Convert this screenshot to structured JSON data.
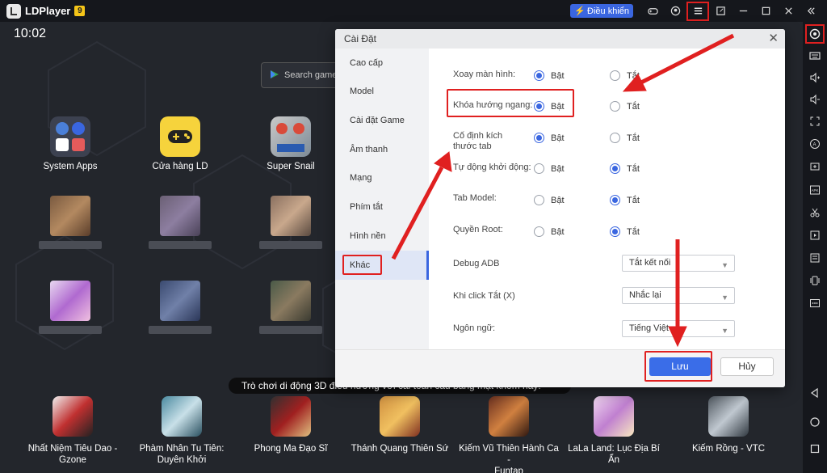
{
  "titlebar": {
    "app_name": "LDPlayer",
    "version_badge": "9",
    "control_label": "Điều khiển",
    "icons": [
      "gamepad-icon",
      "account-icon",
      "menu-icon",
      "popout-icon",
      "minimize-icon",
      "maximize-icon",
      "close-icon",
      "collapse-icon"
    ]
  },
  "screen": {
    "clock": "10:02",
    "search_placeholder": "Search game",
    "apps": [
      {
        "label": "System Apps"
      },
      {
        "label": "Cửa hàng LD"
      },
      {
        "label": "Super Snail"
      }
    ],
    "hint": "Trò chơi di động 3D điều hướng với cái toàn cầu bằng mật khóm này!",
    "dock": [
      {
        "line1": "Nhất Niệm Tiêu Dao -",
        "line2": "Gzone"
      },
      {
        "line1": "Phàm Nhân Tu Tiên:",
        "line2": "Duyên Khởi"
      },
      {
        "line1": "Phong Ma Đạo Sĩ",
        "line2": ""
      },
      {
        "line1": "Thánh Quang Thiên Sứ",
        "line2": ""
      },
      {
        "line1": "Kiếm Vũ Thiên Hành Ca -",
        "line2": "Funtap"
      },
      {
        "line1": "LaLa Land: Lục Địa Bí Ẩn",
        "line2": ""
      },
      {
        "line1": "Kiếm Rồng - VTC",
        "line2": ""
      }
    ]
  },
  "sidebar": {
    "icons": [
      "settings-icon",
      "keyboard-icon",
      "volume-up-icon",
      "volume-down-icon",
      "fullscreen-icon",
      "auto-click-icon",
      "add-screen-icon",
      "apk-icon",
      "scissors-icon",
      "record-icon",
      "operation-record-icon",
      "sync-icon",
      "more-icon",
      "back-icon",
      "home-icon",
      "recents-icon"
    ]
  },
  "dialog": {
    "title": "Cài Đặt",
    "nav": [
      "Cao cấp",
      "Model",
      "Cài đặt Game",
      "Âm thanh",
      "Mạng",
      "Phím tắt",
      "Hình nền",
      "Khác"
    ],
    "active_nav": "Khác",
    "on_label": "Bật",
    "off_label": "Tắt",
    "rows": [
      {
        "label": "Xoay màn hình:",
        "value": "on"
      },
      {
        "label": "Khóa hướng ngang:",
        "value": "on"
      },
      {
        "label": "Cố định kích thước tab",
        "value": "on"
      },
      {
        "label": "Tự động khởi động:",
        "value": "off"
      },
      {
        "label": "Tab Model:",
        "value": "off"
      },
      {
        "label": "Quyền Root:",
        "value": "off"
      }
    ],
    "selects": [
      {
        "label": "Debug ADB",
        "value": "Tắt kết nối"
      },
      {
        "label": "Khi click Tắt (X)",
        "value": "Nhắc lại"
      },
      {
        "label": "Ngôn ngữ:",
        "value": "Tiếng Việt"
      }
    ],
    "save_label": "Lưu",
    "cancel_label": "Hủy"
  },
  "colors": {
    "accent": "#3a66e0",
    "annotation": "#e02020",
    "background": "#23262c"
  }
}
